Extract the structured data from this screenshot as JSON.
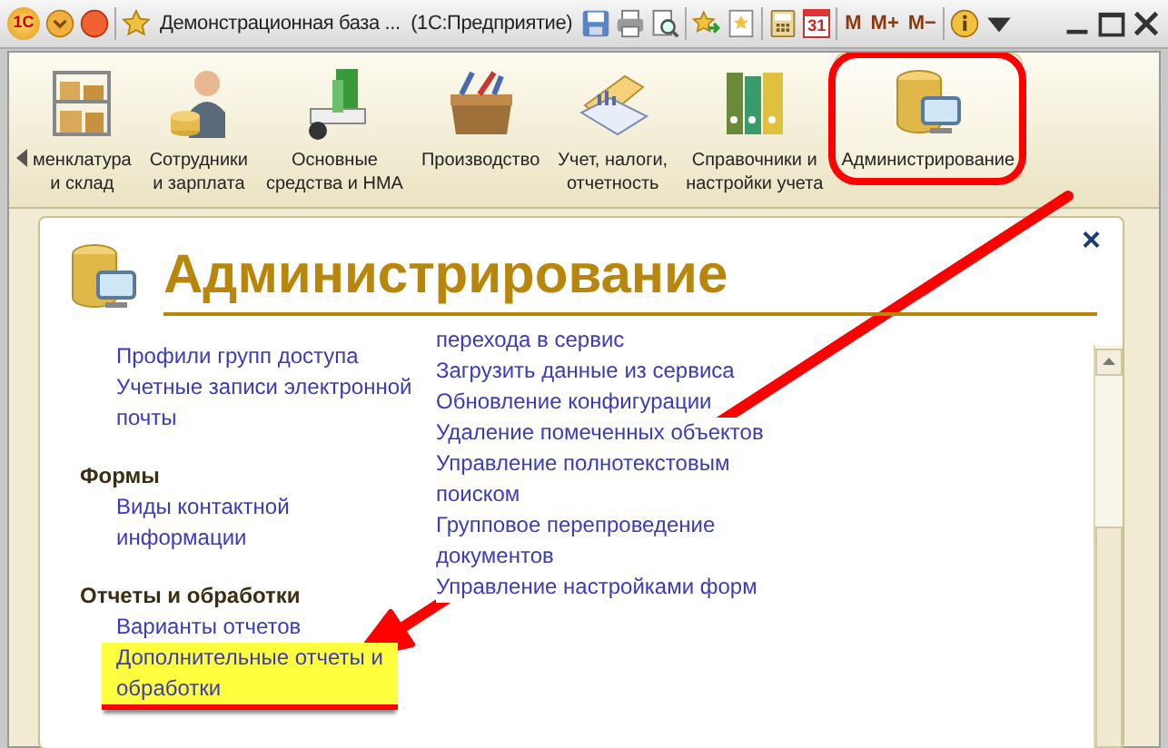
{
  "window": {
    "logo": "1С",
    "title": "Демонстрационная база ...  (1С:Предприятие)",
    "calendar_day": "31",
    "memory_buttons": [
      "M",
      "M+",
      "M−"
    ]
  },
  "sections": [
    {
      "label": "менклатура\nи склад",
      "selected": false,
      "circled": false
    },
    {
      "label": "Сотрудники\nи зарплата",
      "selected": false,
      "circled": false
    },
    {
      "label": "Основные\nсредства и НМА",
      "selected": false,
      "circled": false
    },
    {
      "label": "Производство",
      "selected": false,
      "circled": false
    },
    {
      "label": "Учет, налоги,\nотчетность",
      "selected": false,
      "circled": false
    },
    {
      "label": "Справочники и\nнастройки учета",
      "selected": false,
      "circled": false
    },
    {
      "label": "Администрирование",
      "selected": true,
      "circled": true
    }
  ],
  "panel": {
    "title": "Администрирование",
    "close": "×",
    "columns": [
      {
        "items": [
          {
            "kind": "link",
            "text": "Профили групп доступа",
            "highlighted": false
          },
          {
            "kind": "link",
            "text": "Учетные записи электронной\nпочты",
            "highlighted": false
          },
          {
            "kind": "heading",
            "text": "Формы"
          },
          {
            "kind": "link",
            "text": "Виды контактной\nинформации",
            "highlighted": false
          },
          {
            "kind": "heading",
            "text": "Отчеты и обработки"
          },
          {
            "kind": "link",
            "text": "Варианты отчетов",
            "highlighted": false
          },
          {
            "kind": "link",
            "text": "Дополнительные отчеты и\nобработки",
            "highlighted": true
          }
        ]
      },
      {
        "items": [
          {
            "kind": "link",
            "text": "перехода в сервис",
            "highlighted": false
          },
          {
            "kind": "link",
            "text": "Загрузить данные из сервиса",
            "highlighted": false
          },
          {
            "kind": "link",
            "text": "Обновление конфигурации",
            "highlighted": false
          },
          {
            "kind": "link",
            "text": "Удаление помеченных объектов",
            "highlighted": false
          },
          {
            "kind": "link",
            "text": "Управление полнотекстовым\nпоиском",
            "highlighted": false
          },
          {
            "kind": "link",
            "text": "Групповое перепроведение\nдокументов",
            "highlighted": false
          },
          {
            "kind": "link",
            "text": "Управление настройками форм",
            "highlighted": false
          }
        ]
      }
    ]
  },
  "annotations": [
    {
      "kind": "arrow"
    }
  ]
}
